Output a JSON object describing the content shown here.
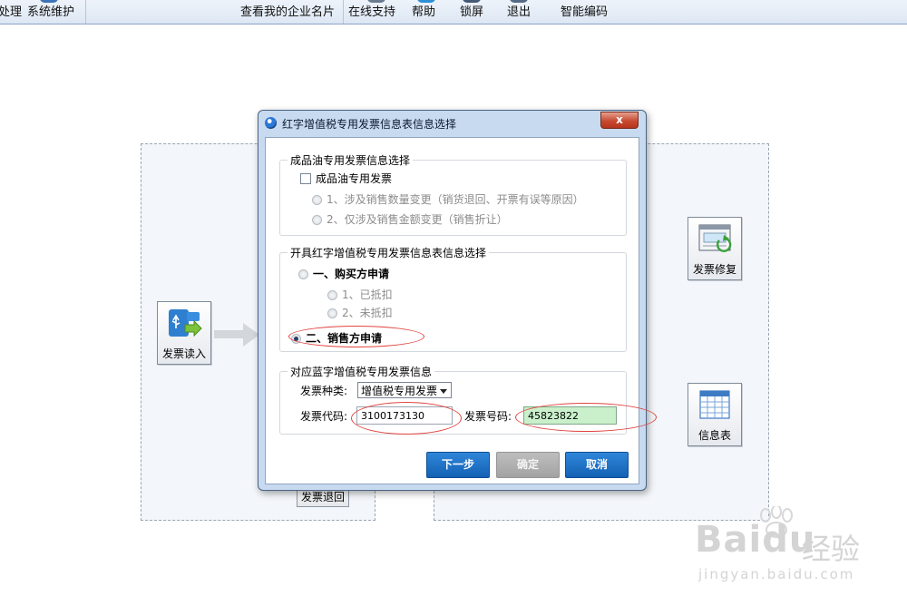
{
  "toolbar": {
    "items": [
      "处理",
      "系统维护",
      "查看我的企业名片",
      "在线支持",
      "帮助",
      "锁屏",
      "退出",
      "智能编码"
    ]
  },
  "background": {
    "tiles": {
      "invoice_read": "发票读入",
      "invoice_repair": "发票修复",
      "info_table": "信息表"
    },
    "invoice_return_button": "发票退回"
  },
  "dialog": {
    "title": "红字增值税专用发票信息表信息选择",
    "close_label": "x",
    "oil_group": {
      "title": "成品油专用发票信息选择",
      "checkbox_label": "成品油专用发票",
      "checkbox_checked": false,
      "options": [
        "1、涉及销售数量变更（销货退回、开票有误等原因）",
        "2、仅涉及销售金额变更（销售折让）"
      ]
    },
    "red_group": {
      "title": "开具红字增值税专用发票信息表信息选择",
      "buyer_option": "一、购买方申请",
      "buyer_suboptions": [
        "1、已抵扣",
        "2、未抵扣"
      ],
      "seller_option": "二、销售方申请",
      "selected": "seller"
    },
    "blue_group": {
      "title": "对应蓝字增值税专用发票信息",
      "type_label": "发票种类:",
      "type_value": "增值税专用发票",
      "code_label": "发票代码:",
      "code_value": "3100173130",
      "number_label": "发票号码:",
      "number_value": "45823822"
    },
    "buttons": {
      "next": "下一步",
      "confirm": "确定",
      "cancel": "取消"
    }
  },
  "watermark": {
    "brand": "Bai",
    "brand_tail": "du",
    "cn": "经验",
    "url": "jingyan.baidu.com"
  },
  "colors": {
    "accent_blue": "#1a6fc7",
    "annotation_red": "#e0443f",
    "focus_green": "#c9f0cb"
  }
}
